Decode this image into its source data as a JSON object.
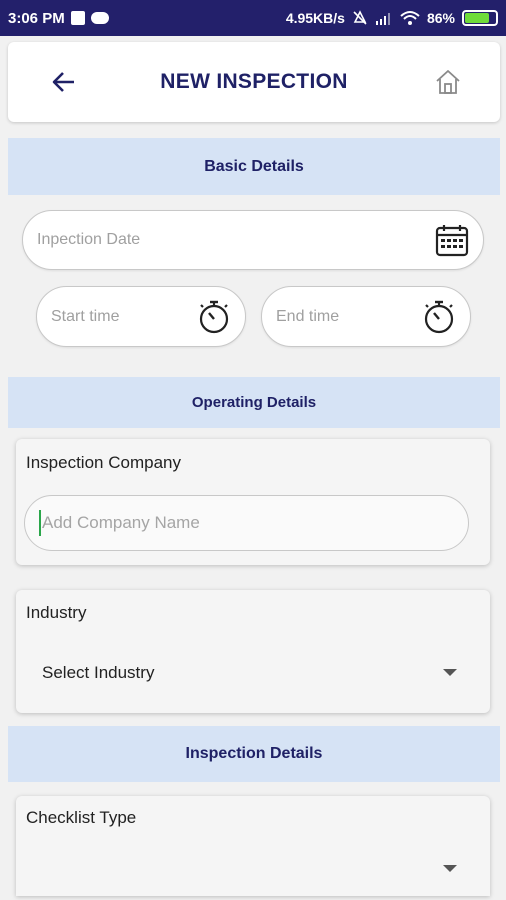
{
  "status_bar": {
    "time": "3:06 PM",
    "network_speed": "4.95KB/s",
    "battery": "86%"
  },
  "header": {
    "title": "NEW INSPECTION"
  },
  "sections": {
    "basic": "Basic Details",
    "operating": "Operating Details",
    "inspection": "Inspection Details"
  },
  "basic_details": {
    "inspection_date_placeholder": "Inpection Date",
    "start_time_placeholder": "Start time",
    "end_time_placeholder": "End time"
  },
  "operating_details": {
    "company_label": "Inspection Company",
    "company_placeholder": "Add Company Name",
    "industry_label": "Industry",
    "industry_selected": "Select Industry"
  },
  "inspection_details": {
    "checklist_label": "Checklist Type",
    "checklist_selected": ""
  },
  "colors": {
    "status_bar": "#23206b",
    "title": "#1f2166",
    "section_bg": "#d6e3f5",
    "battery_fill": "#6fdc3a",
    "cursor": "#2aa64a"
  },
  "icons": {
    "back": "arrow-left-icon",
    "home": "home-icon",
    "calendar": "calendar-icon",
    "stopwatch": "stopwatch-icon",
    "dropdown": "chevron-down-icon"
  }
}
